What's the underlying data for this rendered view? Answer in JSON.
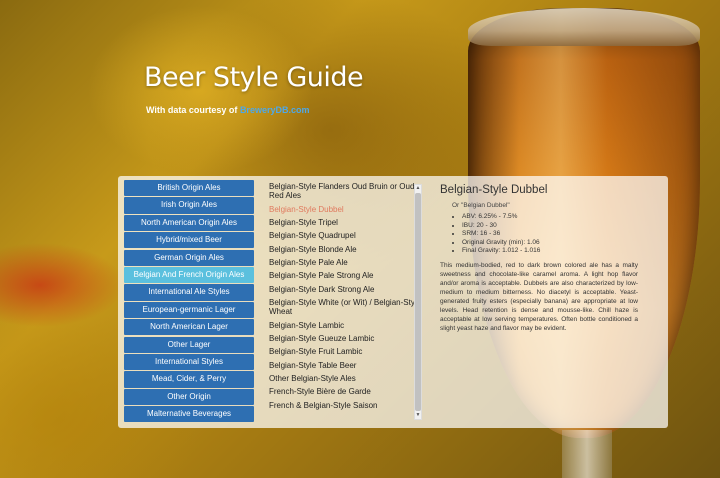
{
  "header": {
    "title": "Beer Style Guide",
    "subtitle_prefix": "With data courtesy of ",
    "subtitle_link": "BreweryDB.com"
  },
  "categories": [
    {
      "label": "British Origin Ales",
      "active": false
    },
    {
      "label": "Irish Origin Ales",
      "active": false
    },
    {
      "label": "North American Origin Ales",
      "active": false
    },
    {
      "label": "Hybrid/mixed Beer",
      "active": false
    },
    {
      "label": "German Origin Ales",
      "active": false
    },
    {
      "label": "Belgian And French Origin Ales",
      "active": true
    },
    {
      "label": "International Ale Styles",
      "active": false
    },
    {
      "label": "European-germanic Lager",
      "active": false
    },
    {
      "label": "North American Lager",
      "active": false
    },
    {
      "label": "Other Lager",
      "active": false
    },
    {
      "label": "International Styles",
      "active": false
    },
    {
      "label": "Mead, Cider, & Perry",
      "active": false
    },
    {
      "label": "Other Origin",
      "active": false
    },
    {
      "label": "Malternative Beverages",
      "active": false
    }
  ],
  "styles": [
    {
      "label": "Belgian-Style Flanders Oud Bruin or Oud Red Ales",
      "active": false
    },
    {
      "label": "Belgian-Style Dubbel",
      "active": true
    },
    {
      "label": "Belgian-Style Tripel",
      "active": false
    },
    {
      "label": "Belgian-Style Quadrupel",
      "active": false
    },
    {
      "label": "Belgian-Style Blonde Ale",
      "active": false
    },
    {
      "label": "Belgian-Style Pale Ale",
      "active": false
    },
    {
      "label": "Belgian-Style Pale Strong Ale",
      "active": false
    },
    {
      "label": "Belgian-Style Dark Strong Ale",
      "active": false
    },
    {
      "label": "Belgian-Style White (or Wit) / Belgian-Style Wheat",
      "active": false
    },
    {
      "label": "Belgian-Style Lambic",
      "active": false
    },
    {
      "label": "Belgian-Style Gueuze Lambic",
      "active": false
    },
    {
      "label": "Belgian-Style Fruit Lambic",
      "active": false
    },
    {
      "label": "Belgian-Style Table Beer",
      "active": false
    },
    {
      "label": "Other Belgian-Style Ales",
      "active": false
    },
    {
      "label": "French-Style Bière de Garde",
      "active": false
    },
    {
      "label": "French & Belgian-Style Saison",
      "active": false
    }
  ],
  "detail": {
    "title": "Belgian-Style Dubbel",
    "alias": "Or \"Belgian Dubbel\"",
    "stats": [
      "ABV: 6.25% - 7.5%",
      "IBU: 20 - 30",
      "SRM: 16 - 36",
      "Original Gravity (min): 1.06",
      "Final Gravity: 1.012 - 1.016"
    ],
    "description": "This medium-bodied, red to dark brown colored ale has a malty sweetness and chocolate-like caramel aroma. A light hop flavor and/or aroma is acceptable. Dubbels are also characterized by low-medium to medium bitterness. No diacetyl is acceptable. Yeast-generated fruity esters (especially banana) are appropriate at low levels. Head retention is dense and mousse-like. Chill haze is acceptable at low serving temperatures. Often bottle conditioned a slight yeast haze and flavor may be evident."
  },
  "scrollbar": {
    "up_icon": "▲",
    "down_icon": "▼"
  },
  "colors": {
    "category_bg": "#2e6fb2",
    "category_active_bg": "#5bc0de",
    "style_active": "#e07a5f",
    "link": "#4ea8e8"
  }
}
